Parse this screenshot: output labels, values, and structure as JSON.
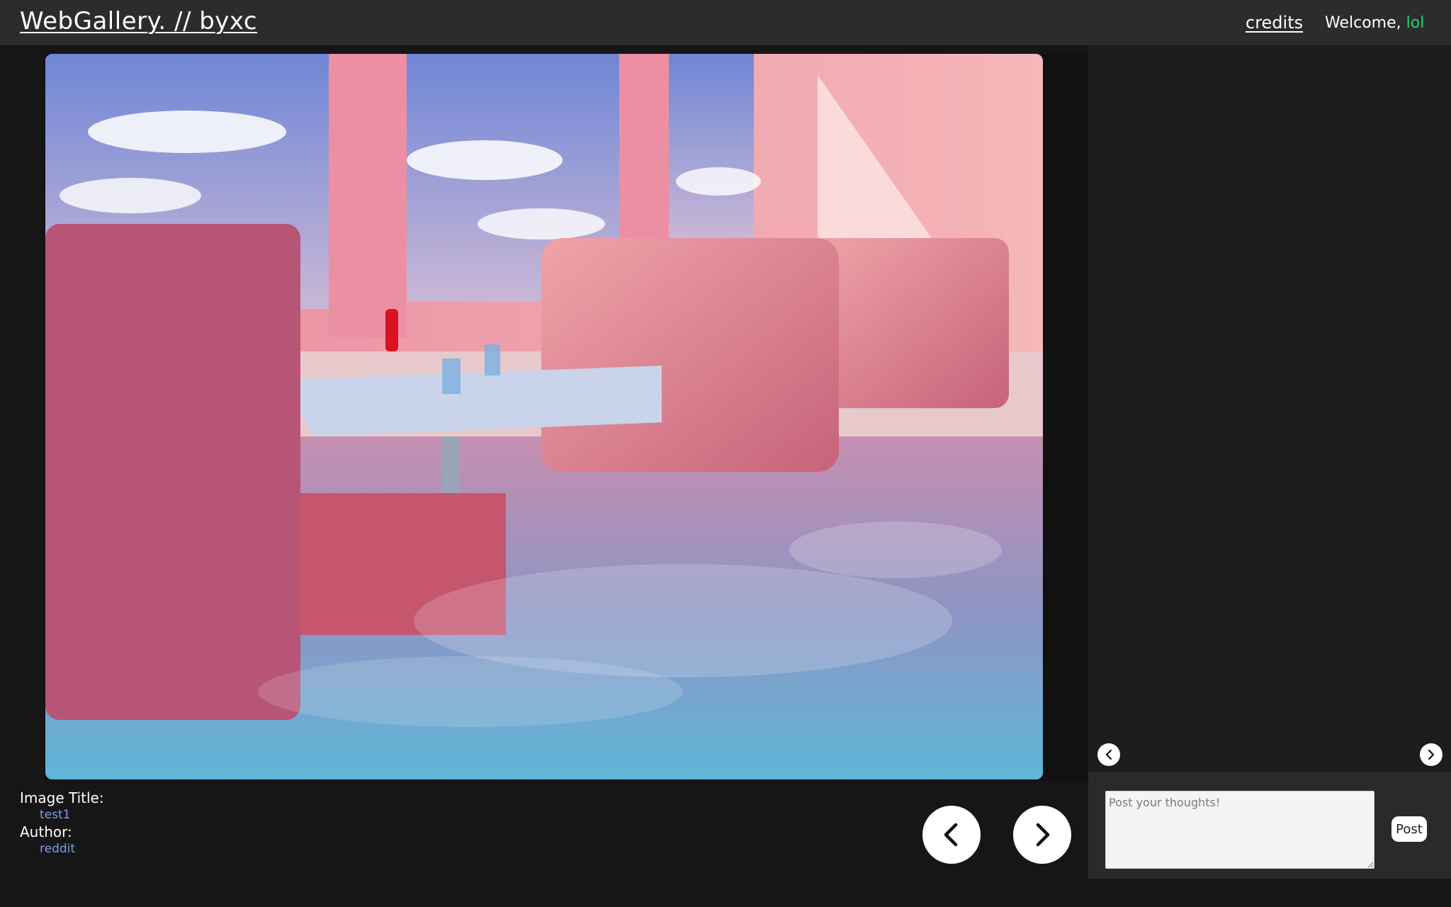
{
  "header": {
    "brand": "WebGallery. // byxc",
    "credits_link": "credits",
    "welcome_prefix": "Welcome, ",
    "username": "lol"
  },
  "image": {
    "title_label": "Image Title:",
    "title_value": "test1",
    "author_label": "Author:",
    "author_value": "reddit"
  },
  "comments": {
    "placeholder": "Post your thoughts!",
    "post_label": "Post"
  },
  "icons": {
    "prev": "chevron-left-icon",
    "next": "chevron-right-icon"
  },
  "colors": {
    "username": "#2ecc71",
    "meta_value": "#7aa0e8",
    "header_bg": "#2c2c2c"
  }
}
